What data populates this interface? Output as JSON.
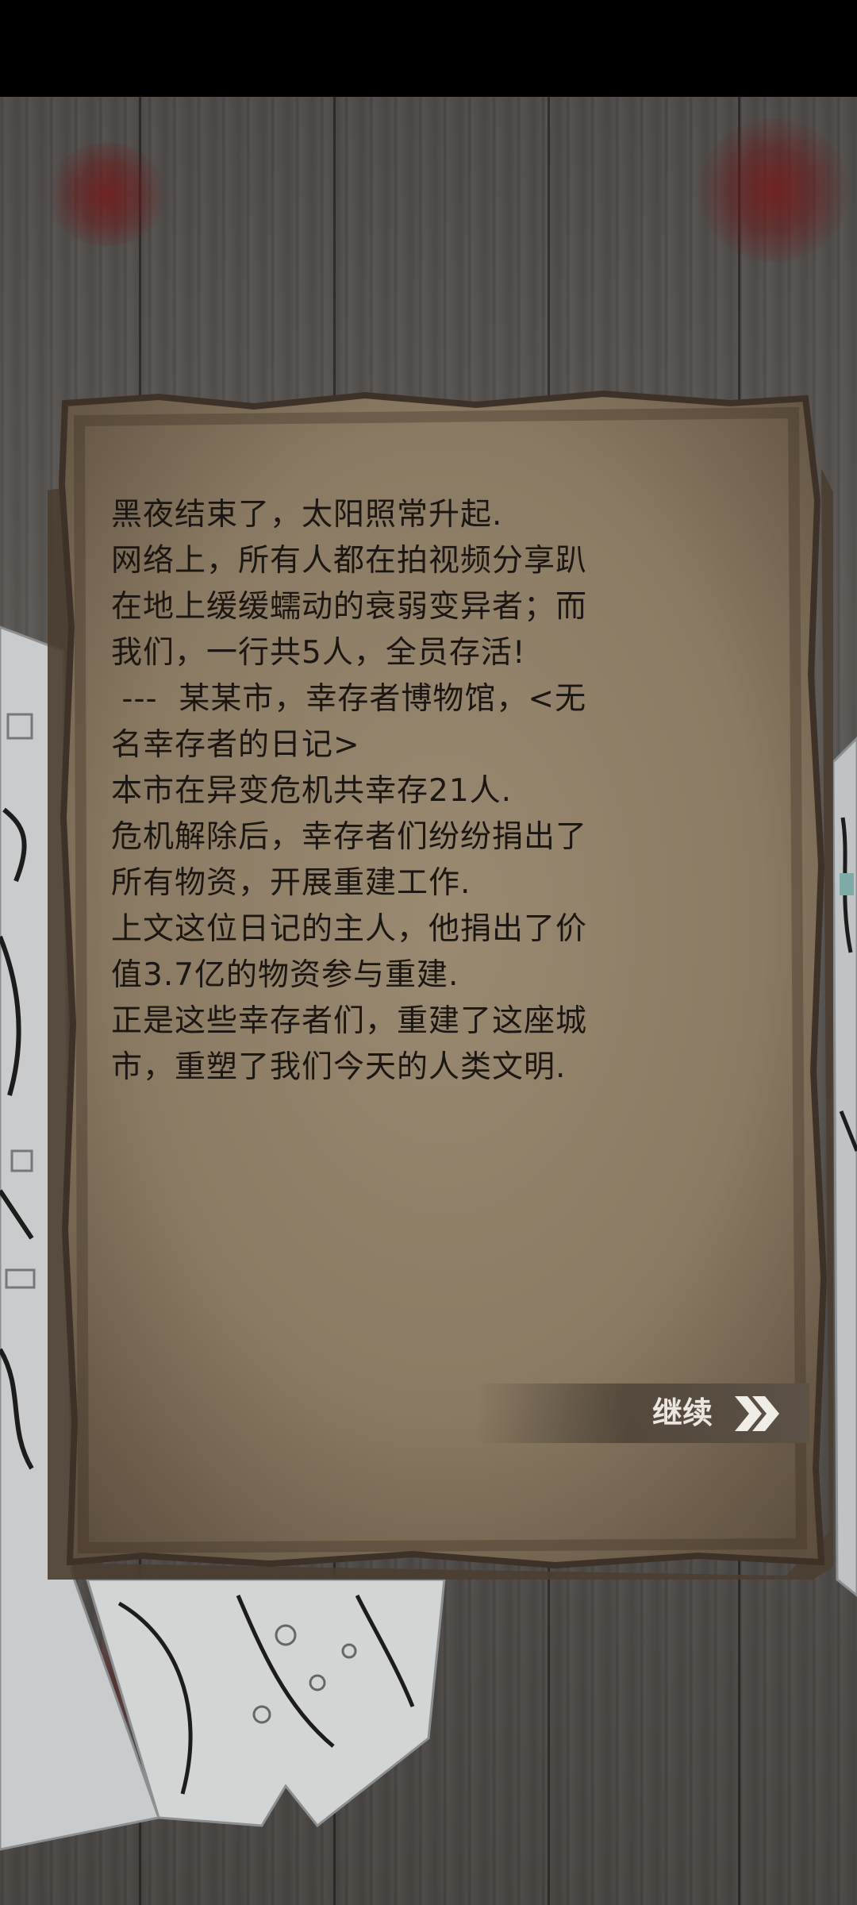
{
  "diary": {
    "lines": [
      "黑夜结束了，太阳照常升起.",
      "网络上，所有人都在拍视频分享趴",
      "在地上缓缓蠕动的衰弱变异者；而",
      "我们，一行共5人，全员存活!",
      " ---  某某市，幸存者博物馆，<无",
      "名幸存者的日记>",
      "本市在异变危机共幸存21人.",
      "危机解除后，幸存者们纷纷捐出了",
      "所有物资，开展重建工作.",
      "上文这位日记的主人，他捐出了价",
      "值3.7亿的物资参与重建.",
      "正是这些幸存者们，重建了这座城",
      "市，重塑了我们今天的人类文明."
    ]
  },
  "continue_button": {
    "label": "继续",
    "icon": "double-chevron-right-icon"
  },
  "colors": {
    "wood": "#55514e",
    "paper": "#8a7a63",
    "ink": "#1b1612",
    "blood": "#7a1414",
    "button_text": "#ebe6df"
  }
}
